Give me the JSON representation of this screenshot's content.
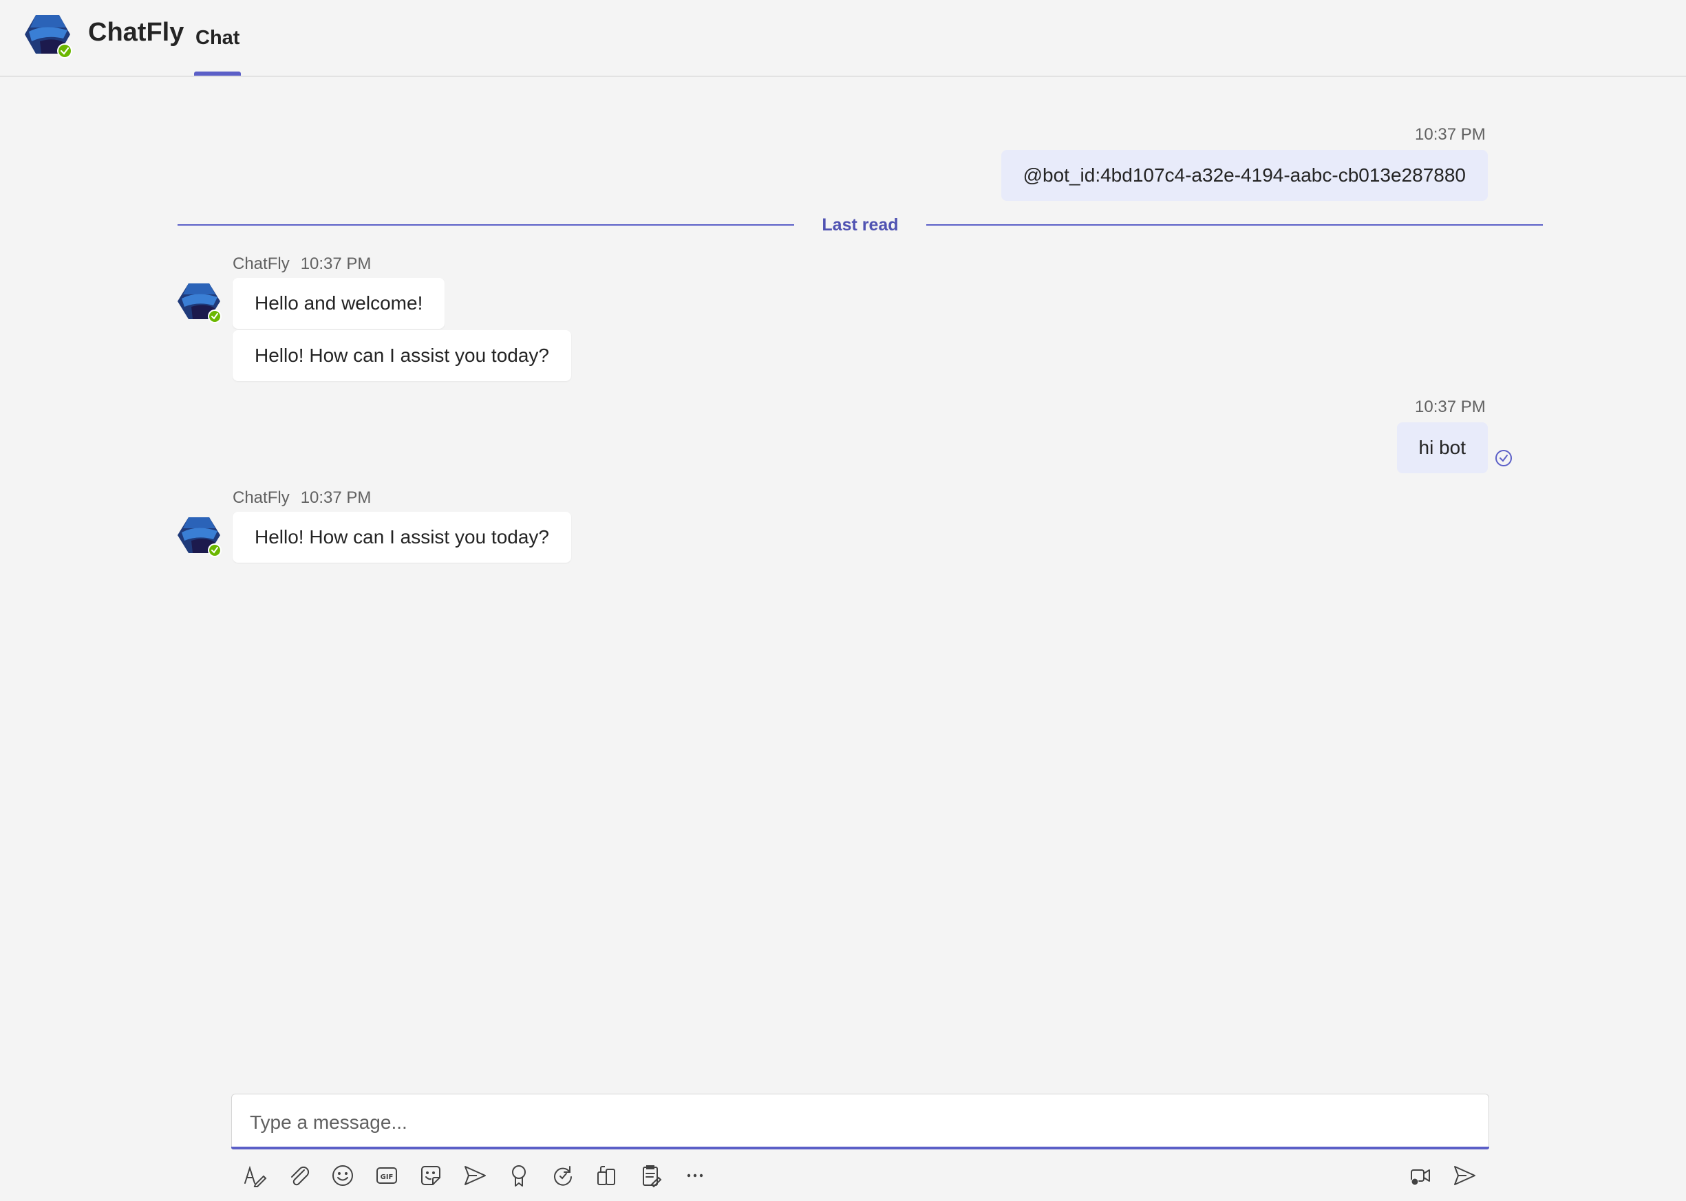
{
  "header": {
    "app_name": "ChatFly",
    "tab_label": "Chat",
    "accent_color": "#5b5fc7"
  },
  "messages": {
    "sent_1": {
      "time": "10:37 PM",
      "text": "@bot_id:4bd107c4-a32e-4194-aabc-cb013e287880"
    },
    "divider_label": "Last read",
    "bot_group_1": {
      "sender": "ChatFly",
      "time": "10:37 PM",
      "texts": [
        "Hello and welcome!",
        "Hello! How can I assist you today?"
      ]
    },
    "sent_2": {
      "time": "10:37 PM",
      "text": "hi bot",
      "status_icon": "read-receipt-icon"
    },
    "bot_group_2": {
      "sender": "ChatFly",
      "time": "10:37 PM",
      "texts": [
        "Hello! How can I assist you today?"
      ]
    }
  },
  "compose": {
    "placeholder": "Type a message...",
    "toolbar_icons": [
      "format-icon",
      "attach-icon",
      "emoji-icon",
      "gif-icon",
      "sticker-icon",
      "schedule-send-icon",
      "praise-icon",
      "loop-icon",
      "apps-icon",
      "notes-icon",
      "more-icon"
    ],
    "right_icons": [
      "video-clip-icon",
      "send-icon"
    ]
  }
}
